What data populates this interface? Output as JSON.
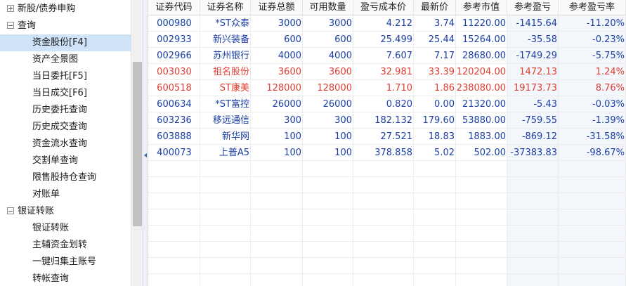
{
  "tree": {
    "items": [
      {
        "type": "group",
        "expanded": false,
        "label": "新股/债券申购"
      },
      {
        "type": "group",
        "expanded": true,
        "label": "查询"
      },
      {
        "type": "child",
        "label": "资金股份[F4]",
        "selected": true
      },
      {
        "type": "child",
        "label": "资产全景图"
      },
      {
        "type": "child",
        "label": "当日委托[F5]"
      },
      {
        "type": "child",
        "label": "当日成交[F6]"
      },
      {
        "type": "child",
        "label": "历史委托查询"
      },
      {
        "type": "child",
        "label": "历史成交查询"
      },
      {
        "type": "child",
        "label": "资金流水查询"
      },
      {
        "type": "child",
        "label": "交割单查询"
      },
      {
        "type": "child",
        "label": "限售股持仓查询"
      },
      {
        "type": "child",
        "label": "对账单"
      },
      {
        "type": "group",
        "expanded": true,
        "label": "银证转账"
      },
      {
        "type": "child",
        "label": "银证转账"
      },
      {
        "type": "child",
        "label": "主辅资金划转"
      },
      {
        "type": "child",
        "label": "一键归集主账号"
      },
      {
        "type": "child",
        "label": "转帐查询"
      }
    ]
  },
  "holdings": {
    "columns": [
      "证券代码",
      "证券名称",
      "证券总额",
      "可用数量",
      "盈亏成本价",
      "最新价",
      "参考市值",
      "参考盈亏",
      "参考盈亏率"
    ],
    "rows": [
      {
        "code": "000980",
        "name": "*ST众泰",
        "total": "3000",
        "available": "3000",
        "cost": "4.212",
        "price": "3.74",
        "value": "11220.00",
        "pnl": "-1415.64",
        "pnl_rate": "-11.20%",
        "color": "blue"
      },
      {
        "code": "002933",
        "name": "新兴装备",
        "total": "600",
        "available": "600",
        "cost": "25.499",
        "price": "25.44",
        "value": "15264.00",
        "pnl": "-35.58",
        "pnl_rate": "-0.23%",
        "color": "blue"
      },
      {
        "code": "002966",
        "name": "苏州银行",
        "total": "4000",
        "available": "4000",
        "cost": "7.607",
        "price": "7.17",
        "value": "28680.00",
        "pnl": "-1749.29",
        "pnl_rate": "-5.75%",
        "color": "blue"
      },
      {
        "code": "003030",
        "name": "祖名股份",
        "total": "3600",
        "available": "3600",
        "cost": "32.981",
        "price": "33.39",
        "value": "120204.00",
        "pnl": "1472.13",
        "pnl_rate": "1.24%",
        "color": "red"
      },
      {
        "code": "600518",
        "name": "ST康美",
        "total": "128000",
        "available": "128000",
        "cost": "1.710",
        "price": "1.86",
        "value": "238080.00",
        "pnl": "19173.73",
        "pnl_rate": "8.76%",
        "color": "red"
      },
      {
        "code": "600634",
        "name": "*ST富控",
        "total": "26000",
        "available": "26000",
        "cost": "0.820",
        "price": "0.00",
        "value": "21320.00",
        "pnl": "-5.43",
        "pnl_rate": "-0.03%",
        "color": "blue"
      },
      {
        "code": "603236",
        "name": "移远通信",
        "total": "300",
        "available": "300",
        "cost": "182.132",
        "price": "179.60",
        "value": "53880.00",
        "pnl": "-759.55",
        "pnl_rate": "-1.39%",
        "color": "blue"
      },
      {
        "code": "603888",
        "name": "新华网",
        "total": "100",
        "available": "100",
        "cost": "27.521",
        "price": "18.83",
        "value": "1883.00",
        "pnl": "-869.12",
        "pnl_rate": "-31.58%",
        "color": "blue"
      },
      {
        "code": "400073",
        "name": "上普A5",
        "total": "100",
        "available": "100",
        "cost": "378.858",
        "price": "5.02",
        "value": "502.00",
        "pnl": "-37383.83",
        "pnl_rate": "-98.67%",
        "color": "blue"
      }
    ]
  },
  "colors": {
    "gain": "#e03c31",
    "loss": "#1b3fa6",
    "selection": "#cfe3f8"
  }
}
